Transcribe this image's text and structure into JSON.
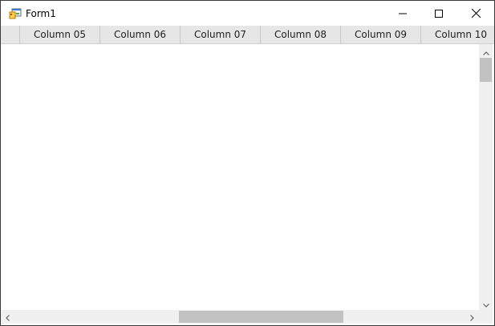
{
  "window": {
    "title": "Form1",
    "icon": "winforms-app-icon",
    "controls": {
      "minimize_icon": "minimize-icon",
      "maximize_icon": "maximize-icon",
      "close_icon": "close-icon"
    }
  },
  "grid": {
    "columns": [
      "Column 05",
      "Column 06",
      "Column 07",
      "Column 08",
      "Column 09",
      "Column 10"
    ],
    "rows": []
  },
  "colors": {
    "header_bg": "#e6e6e6",
    "scrollbar_bg": "#f0f0f0",
    "scroll_thumb": "#c2c2c2"
  }
}
